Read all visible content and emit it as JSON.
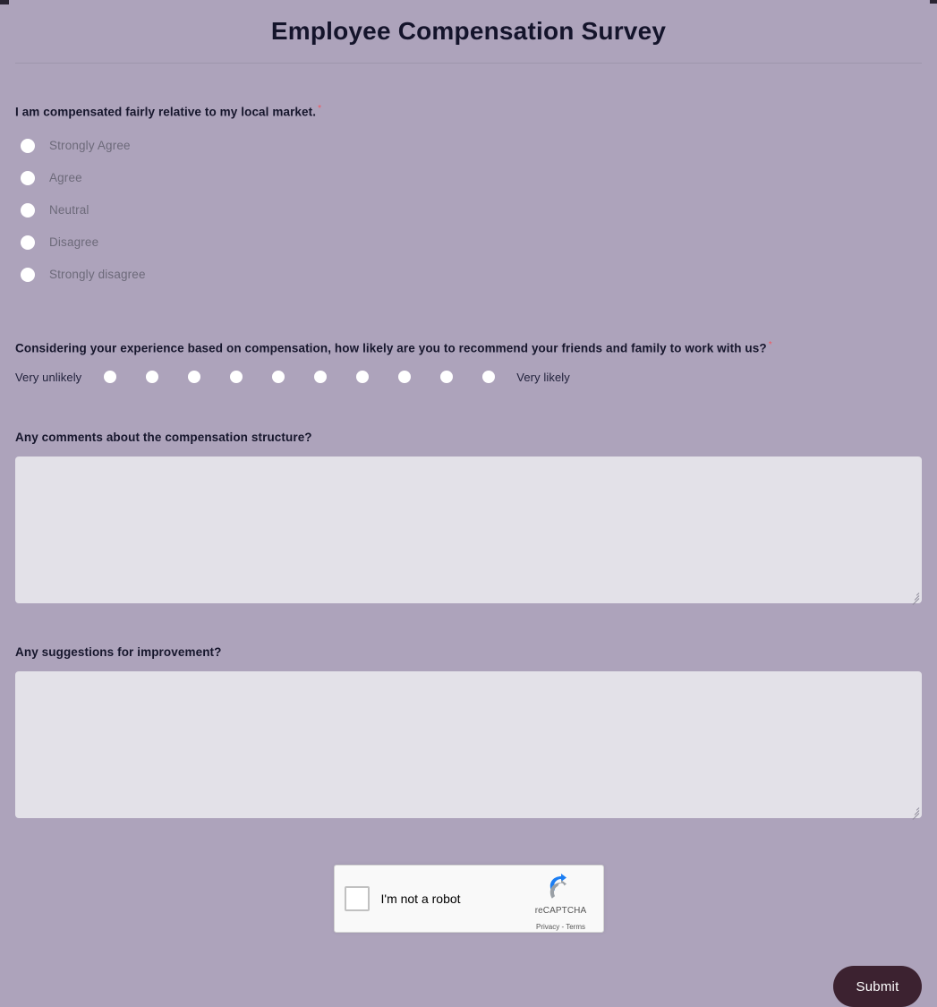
{
  "page": {
    "title": "Employee Compensation Survey"
  },
  "questions": {
    "q1": {
      "label": "I am compensated fairly relative to my local market.",
      "required_marker": "*",
      "options": [
        "Strongly Agree",
        "Agree",
        "Neutral",
        "Disagree",
        "Strongly disagree"
      ]
    },
    "q2": {
      "label": "Considering your experience based on compensation, how likely are you to recommend your friends and family to work with us?",
      "required_marker": "*",
      "scale_low_label": "Very unlikely",
      "scale_high_label": "Very likely",
      "scale_points": 10
    },
    "q3": {
      "label": "Any comments about the compensation structure?",
      "value": "",
      "placeholder": ""
    },
    "q4": {
      "label": "Any suggestions for improvement?",
      "value": "",
      "placeholder": ""
    }
  },
  "captcha": {
    "checkbox_label": "I'm not a robot",
    "brand": "reCAPTCHA",
    "privacy": "Privacy",
    "separator": "-",
    "terms": "Terms"
  },
  "actions": {
    "submit_label": "Submit"
  },
  "colors": {
    "page_background": "#ada3bb",
    "field_background": "#e3e1e8",
    "submit_background": "#3c2230",
    "required_star": "#f2575f",
    "title": "#14142b",
    "option_text": "#6d6a7a"
  }
}
